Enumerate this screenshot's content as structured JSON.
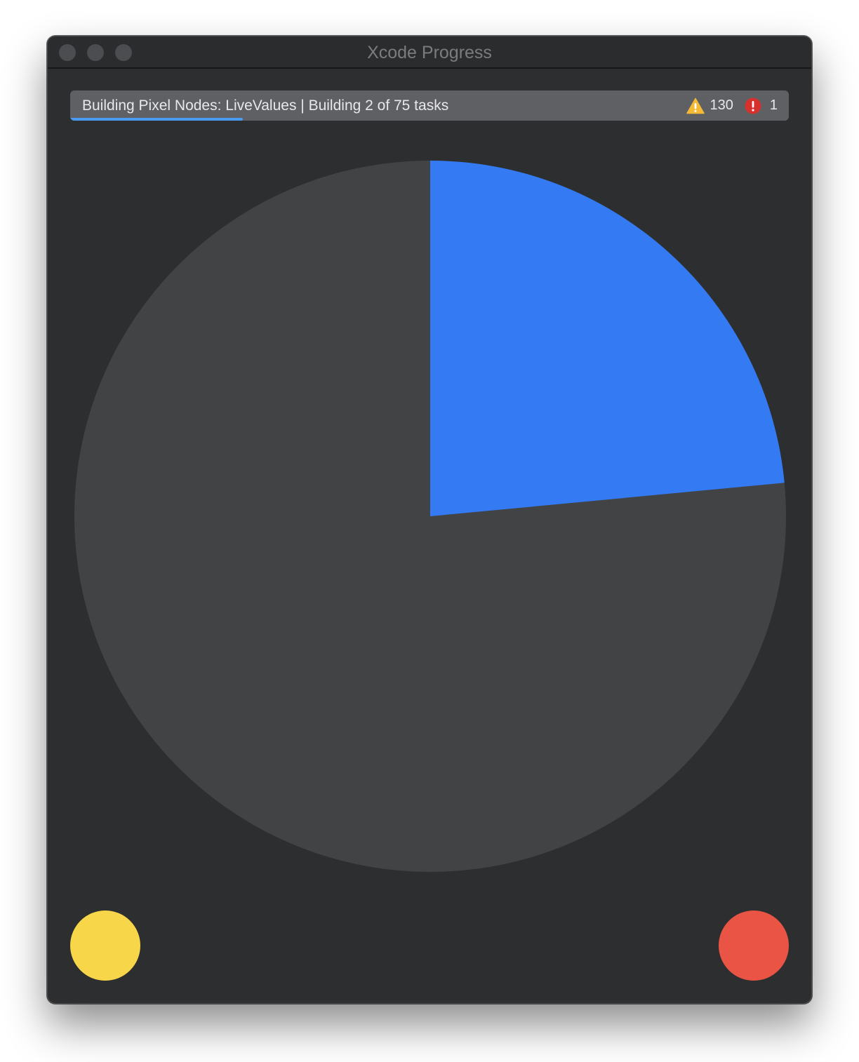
{
  "window": {
    "title": "Xcode Progress"
  },
  "status": {
    "text": "Building Pixel Nodes: LiveValues | Building 2 of 75 tasks",
    "warning_count": "130",
    "error_count": "1",
    "build_progress_fraction": 0.24
  },
  "pie": {
    "progress_fraction": 0.235,
    "fill_color": "#347bf3",
    "track_color": "#424345"
  },
  "indicators": {
    "warning_color": "#f7d64a",
    "error_color": "#e95445"
  },
  "icons": {
    "warning": "warning-triangle-icon",
    "error": "error-exclamation-icon"
  }
}
